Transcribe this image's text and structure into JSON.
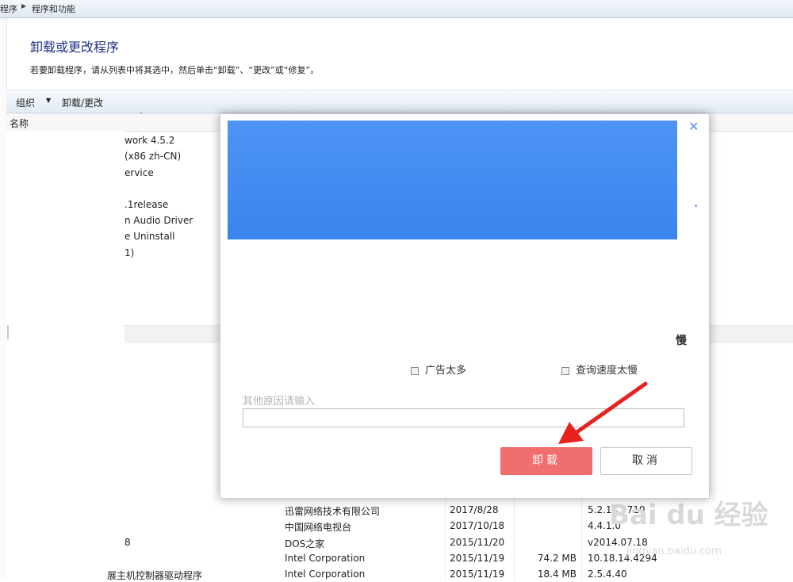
{
  "breadcrumb": {
    "segment1": "程序",
    "segment2": "程序和功能"
  },
  "page": {
    "title": "卸载或更改程序",
    "description": "若要卸载程序，请从列表中将其选中，然后单击“卸载”、“更改”或“修复”。"
  },
  "toolbar": {
    "organize": "组织",
    "organize_arrow": "▼",
    "uninstall_change": "卸载/更改"
  },
  "list": {
    "name_header": "名称",
    "partial_programs": [
      "work 4.5.2",
      "(x86 zh-CN)",
      "ervice",
      ".1release",
      "n Audio Driver",
      "e Uninstall",
      "1)"
    ],
    "rows": [
      {
        "name": "",
        "publisher": "迅雷网络技术有限公司",
        "date": "2017/8/28",
        "size": "",
        "version": "5.2.14.5710"
      },
      {
        "name": "",
        "publisher": "中国网络电视台",
        "date": "2017/10/18",
        "size": "",
        "version": "4.4.1.0"
      },
      {
        "name": "8",
        "publisher": "DOS之家",
        "date": "2015/11/20",
        "size": "",
        "version": "v2014.07.18"
      },
      {
        "name": "",
        "publisher": "Intel Corporation",
        "date": "2015/11/19",
        "size": "74.2 MB",
        "version": "10.18.14.4294"
      },
      {
        "name": "展主机控制器驱动程序",
        "publisher": "Intel Corporation",
        "date": "2015/11/19",
        "size": "18.4 MB",
        "version": "2.5.4.40"
      }
    ]
  },
  "dialog": {
    "close": "✕",
    "slow_partial": "慢",
    "reasons": [
      "广告太多",
      "查询速度太慢"
    ],
    "other_label": "其他原因请输入",
    "other_value": "",
    "uninstall_button": "卸载",
    "cancel_button": "取消"
  },
  "watermark": {
    "text": "Bai du 经验",
    "url": "jingyan.baidu.com"
  },
  "colors": {
    "banner": "#3f89f0",
    "uninstall_button": "#f16e6e",
    "title_blue": "#1e3287",
    "annotation_arrow": "#e8231f"
  }
}
